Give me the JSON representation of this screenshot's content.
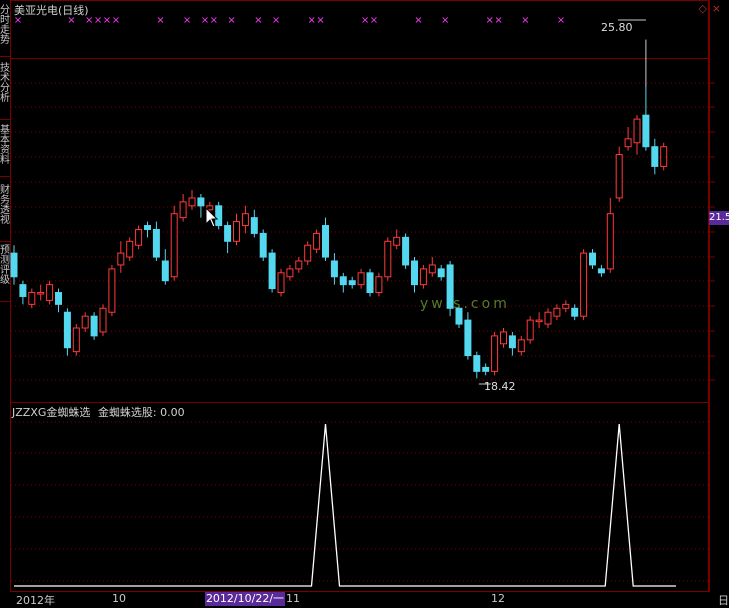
{
  "sidebar": {
    "tabs": [
      {
        "label": "分时走势"
      },
      {
        "label": "技术分析"
      },
      {
        "label": "基本资料"
      },
      {
        "label": "财务透视"
      },
      {
        "label": "预测评级"
      }
    ]
  },
  "chart_title": "美亚光电(日线)",
  "indicator": {
    "name": "JZZXG金蜘蛛选",
    "value_label": "金蜘蛛选股: 0.00"
  },
  "annotations": {
    "high_label": "25.80",
    "low_label": "18.42"
  },
  "price_tag": "21.5",
  "date_axis": {
    "labels": [
      "2012年",
      "10",
      "11",
      "12"
    ],
    "highlight": "2012/10/22/一",
    "right_label": "日"
  },
  "watermark": "yw  s.com",
  "colors": {
    "up": "#ff3a3a",
    "down": "#54d8f0",
    "grid": "#7a0000",
    "marker": "#ff3cff"
  },
  "chart_data": {
    "type": "candlestick",
    "candles": [
      [
        21.6,
        21.0,
        21.8,
        20.8
      ],
      [
        20.8,
        20.5,
        20.9,
        20.3
      ],
      [
        20.3,
        20.6,
        20.7,
        20.2
      ],
      [
        20.6,
        20.6,
        20.8,
        20.4
      ],
      [
        20.4,
        20.8,
        20.9,
        20.3
      ],
      [
        20.6,
        20.3,
        20.7,
        20.1
      ],
      [
        20.1,
        19.2,
        20.2,
        19.0
      ],
      [
        19.1,
        19.7,
        19.8,
        19.0
      ],
      [
        19.7,
        20.0,
        20.1,
        19.6
      ],
      [
        20.0,
        19.5,
        20.1,
        19.4
      ],
      [
        19.6,
        20.2,
        20.3,
        19.5
      ],
      [
        20.1,
        21.2,
        21.3,
        20.0
      ],
      [
        21.3,
        21.6,
        21.9,
        21.1
      ],
      [
        21.5,
        21.9,
        22.0,
        21.4
      ],
      [
        21.8,
        22.2,
        22.3,
        21.7
      ],
      [
        22.3,
        22.2,
        22.4,
        22.0
      ],
      [
        22.2,
        21.5,
        22.4,
        21.4
      ],
      [
        21.4,
        20.9,
        21.7,
        20.8
      ],
      [
        21.0,
        22.6,
        22.8,
        20.9
      ],
      [
        22.5,
        22.9,
        23.1,
        22.4
      ],
      [
        22.8,
        23.0,
        23.2,
        22.7
      ],
      [
        23.0,
        22.8,
        23.1,
        22.5
      ],
      [
        22.7,
        22.8,
        22.9,
        22.6
      ],
      [
        22.8,
        22.3,
        22.9,
        22.2
      ],
      [
        22.3,
        21.9,
        22.4,
        21.6
      ],
      [
        21.9,
        22.4,
        22.6,
        21.8
      ],
      [
        22.3,
        22.6,
        22.8,
        22.1
      ],
      [
        22.5,
        22.1,
        22.7,
        22.0
      ],
      [
        22.1,
        21.5,
        22.2,
        21.4
      ],
      [
        21.6,
        20.7,
        21.7,
        20.6
      ],
      [
        20.6,
        21.1,
        21.2,
        20.5
      ],
      [
        21.0,
        21.2,
        21.3,
        20.9
      ],
      [
        21.2,
        21.4,
        21.5,
        21.1
      ],
      [
        21.4,
        21.8,
        21.9,
        21.3
      ],
      [
        21.7,
        22.1,
        22.2,
        21.6
      ],
      [
        22.3,
        21.5,
        22.5,
        21.4
      ],
      [
        21.4,
        21.0,
        21.6,
        20.8
      ],
      [
        21.0,
        20.8,
        21.1,
        20.6
      ],
      [
        20.9,
        20.8,
        21.0,
        20.7
      ],
      [
        20.8,
        21.1,
        21.2,
        20.7
      ],
      [
        21.1,
        20.6,
        21.2,
        20.5
      ],
      [
        20.6,
        21.0,
        21.1,
        20.5
      ],
      [
        21.0,
        21.9,
        22.0,
        20.9
      ],
      [
        21.8,
        22.0,
        22.2,
        21.7
      ],
      [
        22.0,
        21.3,
        22.1,
        21.2
      ],
      [
        21.4,
        20.8,
        21.5,
        20.6
      ],
      [
        20.8,
        21.2,
        21.3,
        20.7
      ],
      [
        21.1,
        21.3,
        21.5,
        21.0
      ],
      [
        21.2,
        21.0,
        21.3,
        20.9
      ],
      [
        21.3,
        20.2,
        21.4,
        20.0
      ],
      [
        20.2,
        19.8,
        20.3,
        19.7
      ],
      [
        19.9,
        19.0,
        20.1,
        18.9
      ],
      [
        19.0,
        18.6,
        19.1,
        18.42
      ],
      [
        18.7,
        18.6,
        18.8,
        18.5
      ],
      [
        18.6,
        19.5,
        19.6,
        18.5
      ],
      [
        19.3,
        19.6,
        19.7,
        19.2
      ],
      [
        19.5,
        19.2,
        19.6,
        19.0
      ],
      [
        19.1,
        19.4,
        19.5,
        19.0
      ],
      [
        19.4,
        19.9,
        20.0,
        19.3
      ],
      [
        19.9,
        19.9,
        20.1,
        19.7
      ],
      [
        19.8,
        20.1,
        20.2,
        19.7
      ],
      [
        20.0,
        20.2,
        20.3,
        19.9
      ],
      [
        20.2,
        20.3,
        20.4,
        20.1
      ],
      [
        20.2,
        20.0,
        20.3,
        19.9
      ],
      [
        20.0,
        21.6,
        21.7,
        19.9
      ],
      [
        21.6,
        21.3,
        21.7,
        21.2
      ],
      [
        21.2,
        21.1,
        21.3,
        21.0
      ],
      [
        21.2,
        22.6,
        23.0,
        21.1
      ],
      [
        23.0,
        24.1,
        24.3,
        22.9
      ],
      [
        24.3,
        24.5,
        24.8,
        24.2
      ],
      [
        24.4,
        25.0,
        25.1,
        24.1
      ],
      [
        25.1,
        24.3,
        25.8,
        24.2
      ],
      [
        24.3,
        23.8,
        24.5,
        23.6
      ],
      [
        23.8,
        24.3,
        24.4,
        23.7
      ]
    ],
    "marker_indices": [
      0,
      6,
      8,
      9,
      10,
      11,
      16,
      19,
      21,
      22,
      24,
      27,
      29,
      33,
      34,
      39,
      40,
      45,
      48,
      53,
      54,
      57,
      61
    ],
    "signal": {
      "type": "line",
      "spikes_at_candles": [
        35,
        68
      ],
      "values": [
        0,
        1,
        0,
        1,
        0
      ]
    }
  }
}
